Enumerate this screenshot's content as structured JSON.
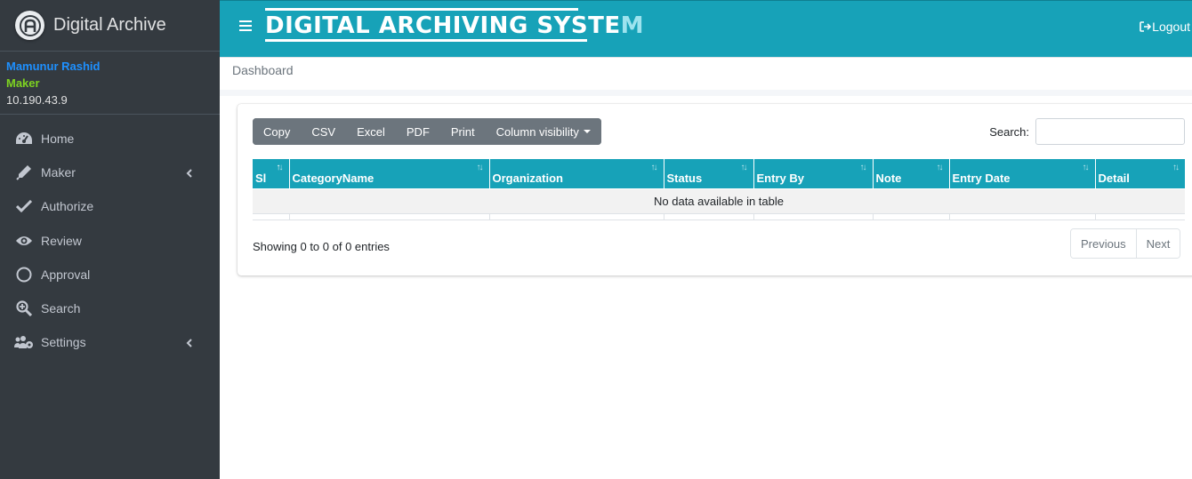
{
  "app": {
    "brand": "Digital Archive"
  },
  "user": {
    "name": "Mamunur Rashid",
    "role": "Maker",
    "ip": "10.190.43.9"
  },
  "sidebar": {
    "items": [
      {
        "label": "Home",
        "icon": "dashboard-icon",
        "has_arrow": false
      },
      {
        "label": "Maker",
        "icon": "pen-icon",
        "has_arrow": true
      },
      {
        "label": "Authorize",
        "icon": "check-icon",
        "has_arrow": false
      },
      {
        "label": "Review",
        "icon": "eye-icon",
        "has_arrow": false
      },
      {
        "label": "Approval",
        "icon": "circle-icon",
        "has_arrow": false
      },
      {
        "label": "Search",
        "icon": "search-plus-icon",
        "has_arrow": false
      },
      {
        "label": "Settings",
        "icon": "users-cog-icon",
        "has_arrow": true
      }
    ]
  },
  "header": {
    "title_main": "DIGITAL ARCHIVING SYSTE",
    "title_fade": "M",
    "logout_label": "Logout"
  },
  "breadcrumb": "Dashboard",
  "table_tools": {
    "buttons": [
      "Copy",
      "CSV",
      "Excel",
      "PDF",
      "Print"
    ],
    "column_visibility": "Column visibility",
    "search_label": "Search:",
    "search_value": ""
  },
  "table": {
    "columns": [
      "Sl",
      "CategoryName",
      "Organization",
      "Status",
      "Entry By",
      "Note",
      "Entry Date",
      "Detail"
    ],
    "empty_message": "No data available in table",
    "info": "Showing 0 to 0 of 0 entries",
    "prev_label": "Previous",
    "next_label": "Next"
  },
  "colors": {
    "header_bg": "#17a2b8",
    "sidebar_bg": "#343a40",
    "user_name": "#1e90ff",
    "user_role": "#7ed321"
  }
}
